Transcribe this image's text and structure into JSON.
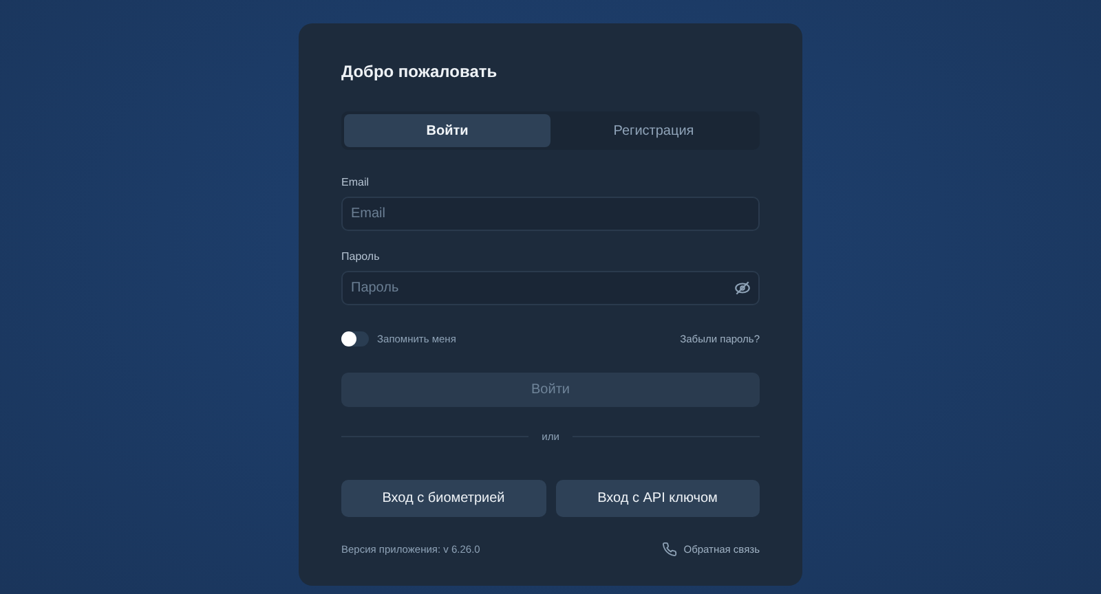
{
  "title": "Добро пожаловать",
  "tabs": [
    {
      "label": "Войти",
      "selected": true
    },
    {
      "label": "Регистрация",
      "selected": false
    }
  ],
  "fields": [
    {
      "label": "Email",
      "placeholder": "Email",
      "kind": "text"
    },
    {
      "label": "Пароль",
      "placeholder": "Пароль",
      "kind": "password"
    }
  ],
  "remember": {
    "label": "Запомнить меня",
    "on": false
  },
  "forgot_link": "Забыли пароль?",
  "submit": {
    "label": "Войти",
    "disabled": true
  },
  "divider": "или",
  "alt_buttons": [
    "Вход с биометрией",
    "Вход с API ключом"
  ],
  "version": "Версия приложения: v 6.26.0",
  "feedback_link": "Обратная связь"
}
